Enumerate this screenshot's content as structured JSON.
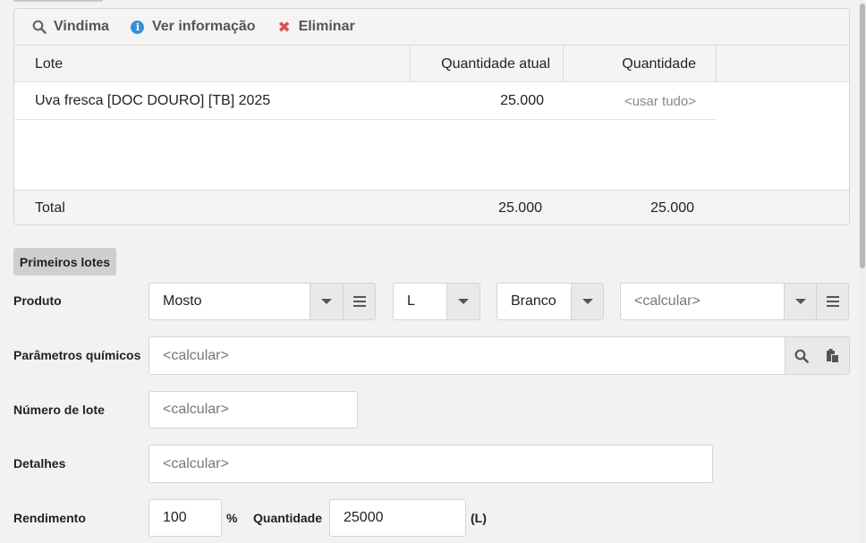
{
  "toolbar": {
    "vindima_label": "Vindima",
    "ver_info_label": "Ver informação",
    "eliminar_label": "Eliminar"
  },
  "grid": {
    "columns": [
      "Lote",
      "Quantidade atual",
      "Quantidade"
    ],
    "rows": [
      {
        "lote": "Uva fresca [DOC DOURO] [TB] 2025",
        "quantidade_atual": "25.000",
        "quantidade": "<usar tudo>"
      }
    ],
    "footer": {
      "label": "Total",
      "quantidade_atual": "25.000",
      "quantidade": "25.000"
    }
  },
  "section_title": "Primeiros lotes",
  "form": {
    "produto": {
      "label": "Produto",
      "value": "Mosto",
      "unit_value": "L",
      "color_value": "Branco",
      "extra_placeholder": "<calcular>"
    },
    "parametros": {
      "label": "Parâmetros químicos",
      "placeholder": "<calcular>"
    },
    "numero_lote": {
      "label": "Número de lote",
      "placeholder": "<calcular>"
    },
    "detalhes": {
      "label": "Detalhes",
      "placeholder": "<calcular>"
    },
    "rendimento": {
      "label": "Rendimento",
      "value": "100",
      "unit": "%"
    },
    "quantidade": {
      "label": "Quantidade",
      "value": "25000",
      "unit": "(L)"
    }
  },
  "colors": {
    "info": "#3d8fd1",
    "danger": "#d9534f",
    "section_bg": "#cfcfcf"
  },
  "icons": {
    "vindima": "search-icon",
    "ver_info": "info-icon",
    "eliminar": "close-icon"
  }
}
